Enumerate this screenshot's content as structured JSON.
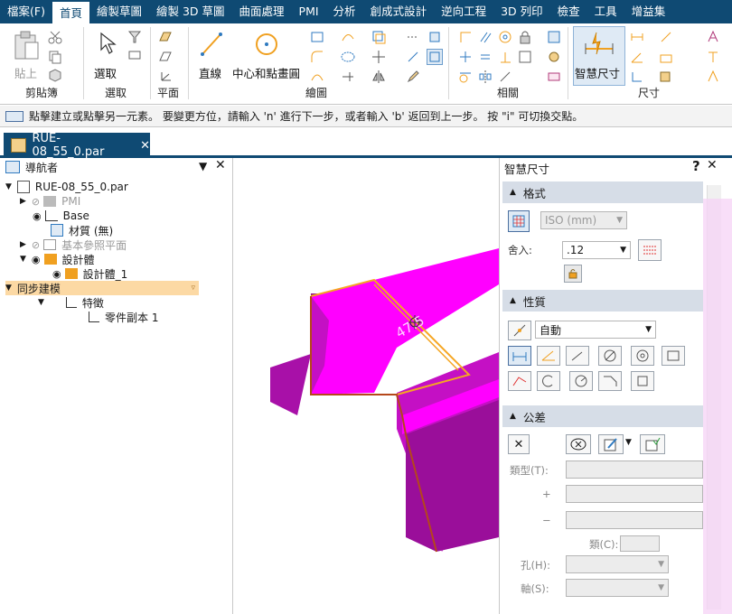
{
  "menu": {
    "items": [
      "檔案(F)",
      "首頁",
      "繪製草圖",
      "繪製 3D 草圖",
      "曲面處理",
      "PMI",
      "分析",
      "創成式設計",
      "逆向工程",
      "3D 列印",
      "檢查",
      "工具",
      "增益集"
    ]
  },
  "ribbon": {
    "clipboard": {
      "paste_label": "貼上",
      "group_label": "剪貼簿"
    },
    "select": {
      "select_label": "選取",
      "group_label": "選取"
    },
    "plane": {
      "group_label": "平面"
    },
    "draw": {
      "line_label": "直線",
      "center_circle_label": "中心和點畫圓",
      "group_label": "繪圖"
    },
    "relate": {
      "group_label": "相關"
    },
    "dimension": {
      "smart_dim_label": "智慧尺寸",
      "group_label": "尺寸"
    }
  },
  "prompt": {
    "text": "點擊建立或點擊另一元素。 要變更方位，請輸入 'n' 進行下一步，或者輸入 'b' 返回到上一步。  按 \"i\" 可切換交點。"
  },
  "document_tab": {
    "name": "RUE-08_55_0.par"
  },
  "navigator": {
    "title": "導航者",
    "root": "RUE-08_55_0.par",
    "pmi": "PMI",
    "base": "Base",
    "material": "材質 (無)",
    "base_planes": "基本參照平面",
    "design_bodies": "設計體",
    "design_body_1": "設計體_1",
    "sync_modeling": "同步建模",
    "features": "特徵",
    "part_copy": "零件副本 1"
  },
  "viewport": {
    "dimension_text": "47.5"
  },
  "smart_dim": {
    "title": "智慧尺寸",
    "help": "?",
    "format_section": "格式",
    "unit_select": "ISO (mm)",
    "round_label": "舍入:",
    "round_value": ".12",
    "property_section": "性質",
    "orientation_value": "自動",
    "tolerance_section": "公差",
    "type_label": "類型(T):",
    "plus_label": "+",
    "minus_label": "−",
    "class_label": "類(C):",
    "hole_label": "孔(H):",
    "shaft_label": "軸(S):"
  },
  "colors": {
    "accent": "#0f4a73",
    "part_face": "#ff00ff",
    "part_edge": "#b5471b",
    "highlight_edge": "#f5a623"
  }
}
